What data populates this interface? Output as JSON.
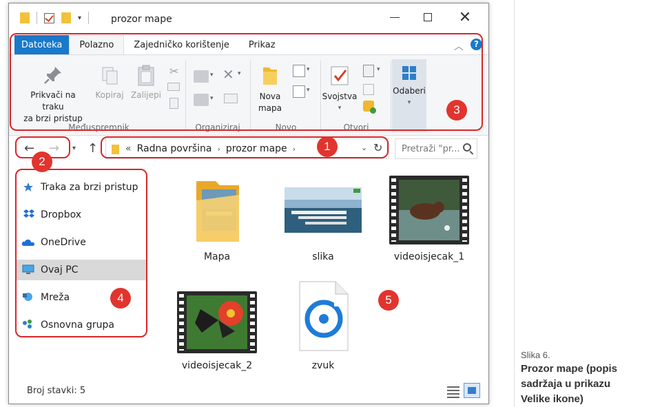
{
  "window": {
    "title": "prozor mape",
    "close_glyph": "✕"
  },
  "ribbon": {
    "tabs": [
      "Datoteka",
      "Polazno",
      "Zajedničko korištenje",
      "Prikaz"
    ],
    "help": "?",
    "groups": {
      "clipboard": {
        "label": "Međuspremnik",
        "pin_line1": "Prikvači na traku",
        "pin_line2": "za brzi pristup",
        "copy": "Kopiraj",
        "paste": "Zalijepi"
      },
      "organize": {
        "label": "Organiziraj"
      },
      "new": {
        "label": "Novo",
        "folder_line1": "Nova",
        "folder_line2": "mapa"
      },
      "open": {
        "label": "Otvori",
        "properties": "Svojstva"
      },
      "select": {
        "label": "Odaberi"
      }
    }
  },
  "address": {
    "prefix": "«",
    "crumbs": [
      "Radna površina",
      "prozor mape"
    ],
    "search_placeholder": "Pretraži \"pr..."
  },
  "nav_pane": {
    "items": [
      {
        "label": "Traka za brzi pristup",
        "icon": "star-pin-icon",
        "selected": false
      },
      {
        "label": "Dropbox",
        "icon": "dropbox-icon",
        "selected": false
      },
      {
        "label": "OneDrive",
        "icon": "cloud-icon",
        "selected": false
      },
      {
        "label": "Ovaj PC",
        "icon": "computer-icon",
        "selected": true
      },
      {
        "label": "Mreža",
        "icon": "network-icon",
        "selected": false
      },
      {
        "label": "Osnovna grupa",
        "icon": "homegroup-icon",
        "selected": false
      }
    ]
  },
  "files": [
    {
      "name": "Mapa",
      "type": "folder"
    },
    {
      "name": "slika",
      "type": "image"
    },
    {
      "name": "videoisjecak_1",
      "type": "video"
    },
    {
      "name": "videoisjecak_2",
      "type": "video"
    },
    {
      "name": "zvuk",
      "type": "audio"
    }
  ],
  "status": {
    "count_text": "Broj stavki: 5"
  },
  "annotations": [
    "1",
    "2",
    "3",
    "4",
    "5"
  ],
  "annotation_color": "#d9262b",
  "caption": {
    "fig": "Slika 6.",
    "line1": "Prozor mape (popis",
    "line2": "sadržaja u prikazu",
    "line3": "Velike ikone)"
  },
  "colors": {
    "file_tab": "#1979ca",
    "folder": "#f3c13a",
    "badge": "#e2342e"
  }
}
